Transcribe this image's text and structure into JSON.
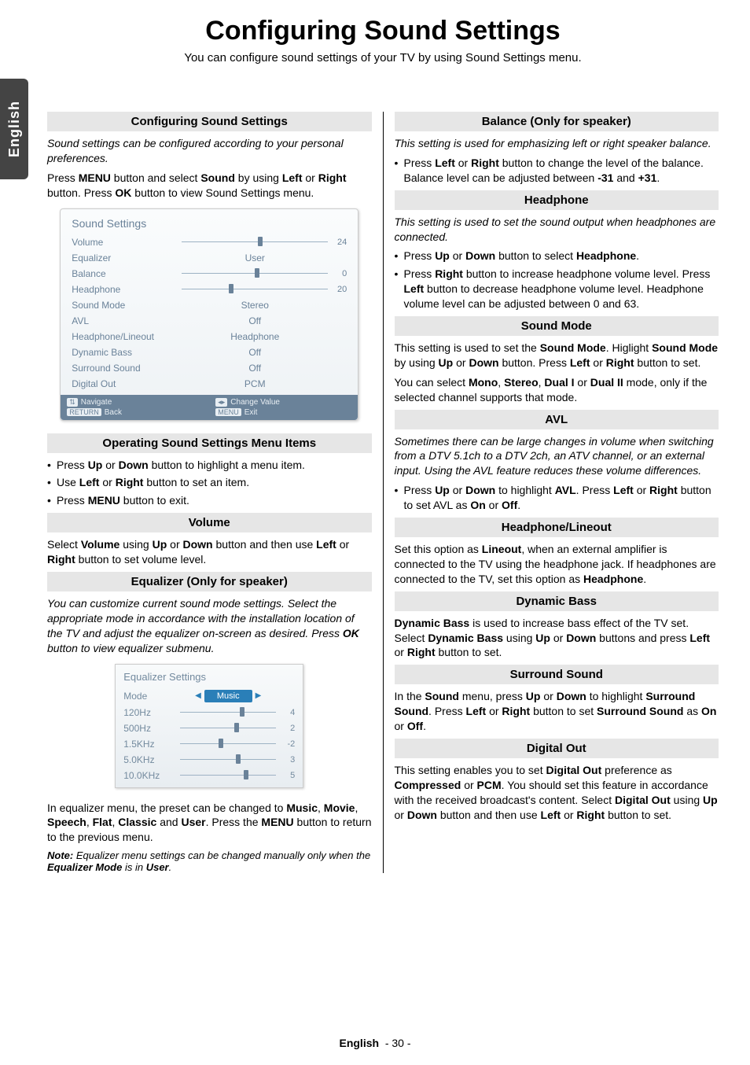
{
  "sidetab": "English",
  "main_title": "Configuring Sound Settings",
  "sub_title": "You can configure sound settings of your TV by using Sound Settings menu.",
  "left": {
    "s1": {
      "title": "Configuring Sound Settings",
      "intro": "Sound settings can be configured according to your personal preferences.",
      "p1a": "Press ",
      "p1b": "MENU",
      "p1c": " button and select ",
      "p1d": "Sound",
      "p1e": " by using ",
      "p1f": "Left",
      "p1g": " or ",
      "p1h": "Right",
      "p1i": " button. Press ",
      "p1j": "OK",
      "p1k": " button to view Sound Settings menu."
    },
    "osd1": {
      "header": "Sound Settings",
      "rows": {
        "volume": {
          "lbl": "Volume",
          "val": "24",
          "thumb": 52
        },
        "equalizer": {
          "lbl": "Equalizer",
          "txt": "User"
        },
        "balance": {
          "lbl": "Balance",
          "val": "0",
          "thumb": 50
        },
        "headphone": {
          "lbl": "Headphone",
          "val": "20",
          "thumb": 32
        },
        "soundmode": {
          "lbl": "Sound Mode",
          "txt": "Stereo"
        },
        "avl": {
          "lbl": "AVL",
          "txt": "Off"
        },
        "hpline": {
          "lbl": "Headphone/Lineout",
          "txt": "Headphone"
        },
        "dbass": {
          "lbl": "Dynamic Bass",
          "txt": "Off"
        },
        "surround": {
          "lbl": "Surround Sound",
          "txt": "Off"
        },
        "digital": {
          "lbl": "Digital Out",
          "txt": "PCM"
        }
      },
      "ftr": {
        "nav": "Navigate",
        "back_badge": "RETURN",
        "back": "Back",
        "change": "Change Value",
        "exit_badge": "MENU",
        "exit": "Exit"
      }
    },
    "s2": {
      "title": "Operating Sound Settings Menu Items",
      "b1a": "Press ",
      "b1b": "Up",
      "b1c": " or ",
      "b1d": "Down",
      "b1e": " button to highlight a menu item.",
      "b2a": "Use ",
      "b2b": "Left",
      "b2c": " or ",
      "b2d": "Right",
      "b2e": " button to set an item.",
      "b3a": "Press ",
      "b3b": "MENU",
      "b3c": " button to exit."
    },
    "s3": {
      "title": "Volume",
      "pa": "Select ",
      "pb": "Volume",
      "pc": " using ",
      "pd": "Up",
      "pe": " or ",
      "pf": "Down",
      "pg": " button and then use ",
      "ph": "Left",
      "pi": " or ",
      "pj": "Right",
      "pk": " button to set volume level."
    },
    "s4": {
      "title": "Equalizer (Only for speaker)",
      "intro": "You can customize current sound mode settings. Select the appropriate mode in accordance with the installation location of the TV and adjust the equalizer on-screen as desired. Press ",
      "introb": "OK",
      "introc": " button to view equalizer submenu."
    },
    "osd2": {
      "header": "Equalizer Settings",
      "rows": {
        "mode": {
          "lbl": "Mode",
          "txt": "Music"
        },
        "r1": {
          "lbl": "120Hz",
          "val": "4",
          "thumb": 62
        },
        "r2": {
          "lbl": "500Hz",
          "val": "2",
          "thumb": 56
        },
        "r3": {
          "lbl": "1.5KHz",
          "val": "-2",
          "thumb": 40
        },
        "r4": {
          "lbl": "5.0KHz",
          "val": "3",
          "thumb": 58
        },
        "r5": {
          "lbl": "10.0KHz",
          "val": "5",
          "thumb": 66
        }
      }
    },
    "s4p2a": "In equalizer menu, the preset can be changed to ",
    "s4p2b": "Music",
    "s4p2c": ", ",
    "s4p2d": "Movie",
    "s4p2e": ", ",
    "s4p2f": "Speech",
    "s4p2g": ", ",
    "s4p2h": "Flat",
    "s4p2i": ", ",
    "s4p2j": "Classic",
    "s4p2k": " and ",
    "s4p2l": "User",
    "s4p2m": ". Press the ",
    "s4p2n": "MENU",
    "s4p2o": " button to return to the previous menu.",
    "note_a": "Note:",
    "note_b": " Equalizer menu settings can be changed  manually only when the ",
    "note_c": "Equalizer Mode",
    "note_d": " is in ",
    "note_e": "User",
    "note_f": "."
  },
  "right": {
    "s1": {
      "title": "Balance (Only for speaker)",
      "intro": "This setting is used for emphasizing left or right speaker balance.",
      "b1a": "Press ",
      "b1b": "Left",
      "b1c": " or ",
      "b1d": "Right",
      "b1e": " button to change the level of the balance. Balance level can be adjusted between ",
      "b1f": "-31",
      "b1g": " and ",
      "b1h": "+31",
      "b1i": "."
    },
    "s2": {
      "title": "Headphone",
      "intro": "This setting is used to set the sound output when headphones are connected.",
      "b1a": "Press ",
      "b1b": "Up",
      "b1c": " or ",
      "b1d": "Down",
      "b1e": " button to select ",
      "b1f": "Headphone",
      "b1g": ".",
      "b2a": "Press ",
      "b2b": "Right",
      "b2c": " button to increase headphone volume level. Press ",
      "b2d": "Left",
      "b2e": " button to decrease headphone volume level. Headphone volume level can be adjusted between 0 and 63."
    },
    "s3": {
      "title": "Sound Mode",
      "p1a": "This setting is used to set the ",
      "p1b": "Sound Mode",
      "p1c": ". Higlight ",
      "p1d": "Sound Mode",
      "p1e": " by using ",
      "p1f": "Up",
      "p1g": " or ",
      "p1h": "Down",
      "p1i": " button. Press ",
      "p1j": "Left",
      "p1k": " or ",
      "p1l": "Right",
      "p1m": " button to set.",
      "p2a": "You can select ",
      "p2b": "Mono",
      "p2c": ", ",
      "p2d": "Stereo",
      "p2e": ", ",
      "p2f": "Dual I",
      "p2g": " or ",
      "p2h": "Dual II",
      "p2i": " mode, only if the selected channel supports that mode."
    },
    "s4": {
      "title": "AVL",
      "intro": "Sometimes there can be large changes in volume when switching from a DTV 5.1ch to a DTV 2ch, an ATV channel, or an external input. Using the AVL feature reduces these volume differences.",
      "b1a": "Press ",
      "b1b": "Up",
      "b1c": " or ",
      "b1d": "Down",
      "b1e": " to highlight ",
      "b1f": "AVL",
      "b1g": ". Press ",
      "b1h": "Left",
      "b1i": " or ",
      "b1j": "Right",
      "b1k": " button to set AVL as ",
      "b1l": "On",
      "b1m": " or ",
      "b1n": "Off",
      "b1o": "."
    },
    "s5": {
      "title": "Headphone/Lineout",
      "p1a": "Set this option as ",
      "p1b": "Lineout",
      "p1c": ", when an external amplifier is connected to the TV using the headphone jack. If headphones are connected to the TV, set this option as ",
      "p1d": "Headphone",
      "p1e": "."
    },
    "s6": {
      "title": "Dynamic Bass",
      "p1a": "Dynamic Bass",
      "p1b": " is used to increase bass effect of the TV set. Select ",
      "p1c": "Dynamic Bass",
      "p1d": " using ",
      "p1e": "Up",
      "p1f": " or ",
      "p1g": "Down",
      "p1h": " buttons and press ",
      "p1i": "Left",
      "p1j": " or ",
      "p1k": "Right",
      "p1l": " button to set."
    },
    "s7": {
      "title": "Surround Sound",
      "p1a": "In the ",
      "p1b": "Sound",
      "p1c": " menu, press ",
      "p1d": "Up",
      "p1e": " or ",
      "p1f": "Down",
      "p1g": " to highlight ",
      "p1h": "Surround Sound",
      "p1i": ". Press ",
      "p1j": "Left",
      "p1k": " or ",
      "p1l": "Right",
      "p1m": " button to set ",
      "p1n": "Surround Sound",
      "p1o": " as ",
      "p1p": "On",
      "p1q": " or ",
      "p1r": "Off",
      "p1s": "."
    },
    "s8": {
      "title": "Digital Out",
      "p1a": "This setting enables you to set ",
      "p1b": "Digital Out",
      "p1c": " preference as ",
      "p1d": "Compressed",
      "p1e": " or ",
      "p1f": "PCM",
      "p1g": ". You should set this feature in accordance with the received broadcast's content. Select ",
      "p1h": "Digital Out",
      "p1i": " using ",
      "p1j": "Up",
      "p1k": " or ",
      "p1l": "Down",
      "p1m": " button and then use ",
      "p1n": "Left",
      "p1o": " or ",
      "p1p": "Right",
      "p1q": " button to set."
    }
  },
  "footer": {
    "lang": "English",
    "page": "- 30 -"
  }
}
